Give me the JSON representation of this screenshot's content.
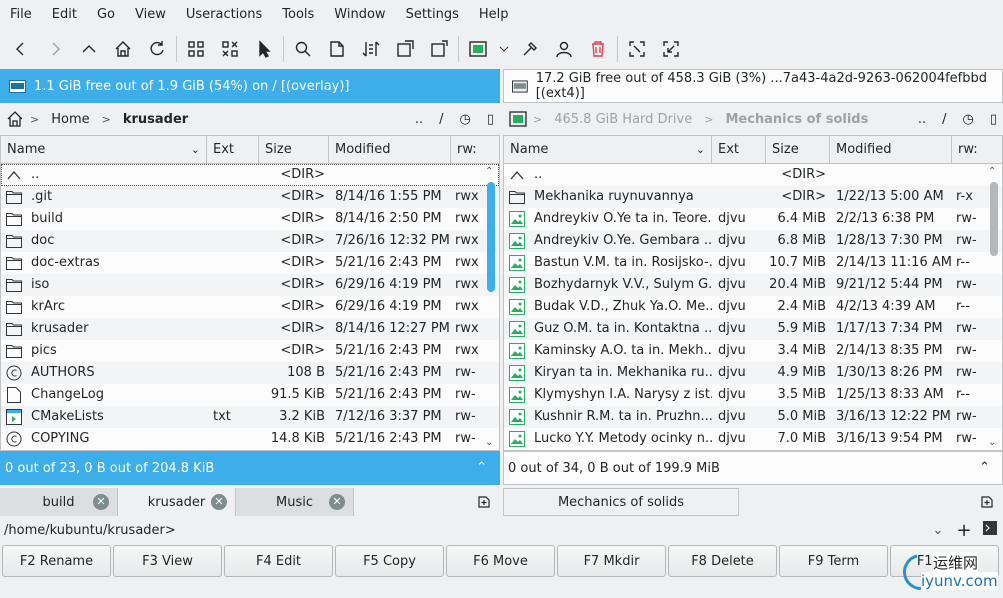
{
  "menubar": [
    "File",
    "Edit",
    "Go",
    "View",
    "Useractions",
    "Tools",
    "Window",
    "Settings",
    "Help"
  ],
  "toolbar": {
    "icons": [
      "back-icon",
      "forward-icon",
      "up-icon",
      "home-icon",
      "reload-icon",
      "select-group-icon",
      "unselect-group-icon",
      "invert-selection-icon",
      "search-icon",
      "new-file-icon",
      "compare-dirs-icon",
      "copy-panel-icon",
      "move-panel-icon",
      "terminal-icon",
      "dropdown-arrow-icon",
      "tools-icon",
      "user-icon",
      "trash-icon",
      "fullscreen-icon",
      "restore-icon"
    ]
  },
  "left": {
    "free_space": "1.1 GiB free out of 1.9 GiB (54%) on / [(overlay)]",
    "breadcrumb": [
      "Home",
      "krusader"
    ],
    "nav_tools": [
      "..",
      "/"
    ],
    "headers": [
      "Name",
      "Ext",
      "Size",
      "Modified",
      "rw:"
    ],
    "rows": [
      {
        "icon": "up",
        "name": "..",
        "ext": "",
        "size": "<DIR>",
        "modified": "",
        "rw": ""
      },
      {
        "icon": "folder",
        "name": ".git",
        "ext": "",
        "size": "<DIR>",
        "modified": "8/14/16 1:55 PM",
        "rw": "rwx"
      },
      {
        "icon": "folder",
        "name": "build",
        "ext": "",
        "size": "<DIR>",
        "modified": "8/14/16 2:50 PM",
        "rw": "rwx"
      },
      {
        "icon": "folder",
        "name": "doc",
        "ext": "",
        "size": "<DIR>",
        "modified": "7/26/16 12:32 PM",
        "rw": "rwx"
      },
      {
        "icon": "folder",
        "name": "doc-extras",
        "ext": "",
        "size": "<DIR>",
        "modified": "5/21/16 2:43 PM",
        "rw": "rwx"
      },
      {
        "icon": "folder",
        "name": "iso",
        "ext": "",
        "size": "<DIR>",
        "modified": "6/29/16 4:19 PM",
        "rw": "rwx"
      },
      {
        "icon": "folder",
        "name": "krArc",
        "ext": "",
        "size": "<DIR>",
        "modified": "6/29/16 4:19 PM",
        "rw": "rwx"
      },
      {
        "icon": "folder",
        "name": "krusader",
        "ext": "",
        "size": "<DIR>",
        "modified": "8/14/16 12:27 PM",
        "rw": "rwx"
      },
      {
        "icon": "folder",
        "name": "pics",
        "ext": "",
        "size": "<DIR>",
        "modified": "5/21/16 2:43 PM",
        "rw": "rwx"
      },
      {
        "icon": "copyright",
        "name": "AUTHORS",
        "ext": "",
        "size": "108 B",
        "modified": "5/21/16 2:43 PM",
        "rw": "rw-"
      },
      {
        "icon": "file",
        "name": "ChangeLog",
        "ext": "",
        "size": "91.5 KiB",
        "modified": "5/21/16 2:43 PM",
        "rw": "rw-"
      },
      {
        "icon": "cmake",
        "name": "CMakeLists",
        "ext": "txt",
        "size": "3.2 KiB",
        "modified": "7/12/16 3:37 PM",
        "rw": "rw-"
      },
      {
        "icon": "copyright",
        "name": "COPYING",
        "ext": "",
        "size": "14.8 KiB",
        "modified": "5/21/16 2:43 PM",
        "rw": "rw-"
      }
    ],
    "summary": "0 out of 23, 0 B out of 204.8 KiB"
  },
  "right": {
    "free_space": "17.2 GiB free out of 458.3 GiB (3%) ...7a43-4a2d-9263-062004fefbbd [(ext4)]",
    "breadcrumb": [
      "465.8 GiB Hard Drive",
      "Mechanics of solids"
    ],
    "nav_tools": [
      "..",
      "/"
    ],
    "headers": [
      "Name",
      "Ext",
      "Size",
      "Modified",
      "rw:"
    ],
    "rows": [
      {
        "icon": "up",
        "name": "..",
        "ext": "",
        "size": "<DIR>",
        "modified": "",
        "rw": ""
      },
      {
        "icon": "folder",
        "name": "Mekhanika ruynuvannya",
        "ext": "",
        "size": "<DIR>",
        "modified": "1/22/13 5:00 AM",
        "rw": "r-x"
      },
      {
        "icon": "image",
        "name": "Andreykiv O.Ye ta in. Teore...",
        "ext": "djvu",
        "size": "6.4 MiB",
        "modified": "2/2/13 6:38 PM",
        "rw": "rw-"
      },
      {
        "icon": "image",
        "name": "Andreykiv O.Ye. Gembara ...",
        "ext": "djvu",
        "size": "6.8 MiB",
        "modified": "1/28/13 7:30 PM",
        "rw": "rw-"
      },
      {
        "icon": "image",
        "name": "Bastun V.M. ta in. Rosijsko-...",
        "ext": "djvu",
        "size": "10.7 MiB",
        "modified": "2/14/13 11:16 AM",
        "rw": "r--"
      },
      {
        "icon": "image",
        "name": "Bozhydarnyk V.V., Sulym G...",
        "ext": "djvu",
        "size": "20.4 MiB",
        "modified": "9/21/12 5:44 PM",
        "rw": "rw-"
      },
      {
        "icon": "image",
        "name": "Budak V.D., Zhuk Ya.O. Me...",
        "ext": "djvu",
        "size": "2.4 MiB",
        "modified": "4/2/13 4:39 AM",
        "rw": "r--"
      },
      {
        "icon": "image",
        "name": "Guz O.M. ta in. Kontaktna ...",
        "ext": "djvu",
        "size": "5.9 MiB",
        "modified": "1/17/13 7:34 PM",
        "rw": "rw-"
      },
      {
        "icon": "image",
        "name": "Kaminsky A.O. ta in. Mekh...",
        "ext": "djvu",
        "size": "3.4 MiB",
        "modified": "2/14/13 8:35 PM",
        "rw": "rw-"
      },
      {
        "icon": "image",
        "name": "Kiryan ta in. Mekhanika ru...",
        "ext": "djvu",
        "size": "4.9 MiB",
        "modified": "1/30/13 8:26 PM",
        "rw": "rw-"
      },
      {
        "icon": "image",
        "name": "Klymyshyn I.A. Narysy z ist...",
        "ext": "djvu",
        "size": "3.5 MiB",
        "modified": "1/25/13 8:33 AM",
        "rw": "r--"
      },
      {
        "icon": "image",
        "name": "Kushnir R.M. ta in. Pruzhn...",
        "ext": "djvu",
        "size": "5.0 MiB",
        "modified": "3/16/13 12:22 PM",
        "rw": "rw-"
      },
      {
        "icon": "image",
        "name": "Lucko Y.Y. Metody ocinky n...",
        "ext": "djvu",
        "size": "7.0 MiB",
        "modified": "3/16/13 9:54 PM",
        "rw": "rw-"
      }
    ],
    "summary": "0 out of 34, 0 B out of 199.9 MiB"
  },
  "tabs_left": [
    {
      "label": "build",
      "selected": false
    },
    {
      "label": "krusader",
      "selected": true
    },
    {
      "label": "Music",
      "selected": false
    }
  ],
  "tabs_right": [
    {
      "label": "Mechanics of solids",
      "selected": true
    }
  ],
  "cmdline": {
    "path": "/home/kubuntu/krusader>"
  },
  "fkeys": [
    "F2 Rename",
    "F3 View",
    "F4 Edit",
    "F5 Copy",
    "F6 Move",
    "F7 Mkdir",
    "F8 Delete",
    "F9 Term",
    "F10 Quit"
  ],
  "watermark": {
    "cn": "运维网",
    "url": "iyunv.com"
  },
  "colors": {
    "accent": "#3daee9",
    "trash": "#da4453",
    "image_icon": "#27ae60"
  }
}
